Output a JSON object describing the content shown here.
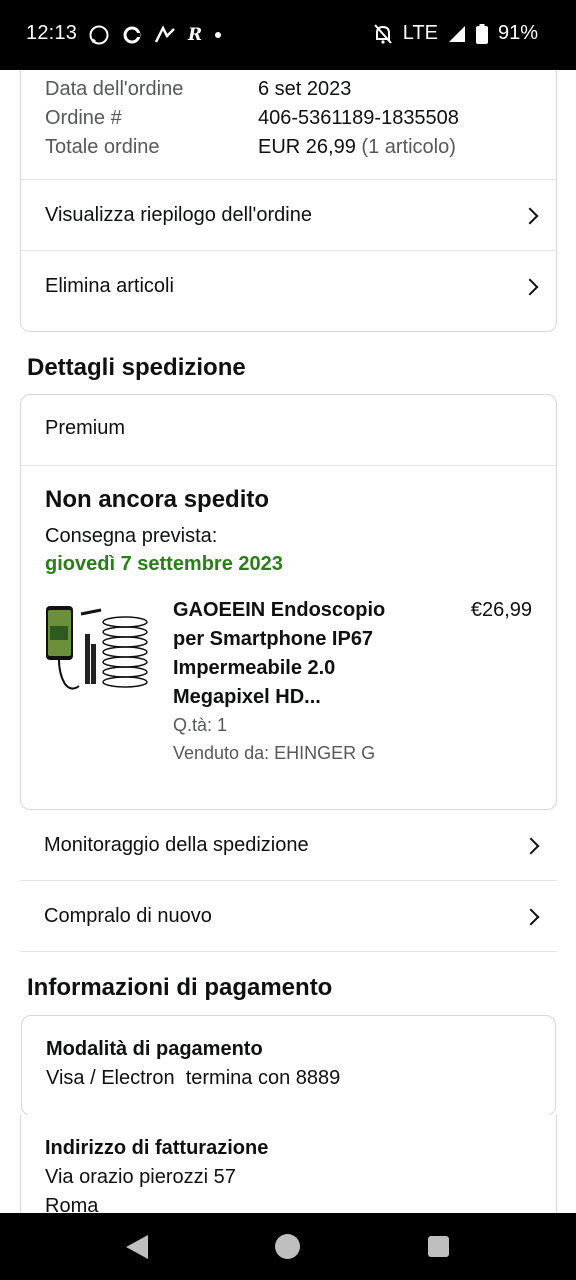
{
  "status_bar": {
    "time": "12:13",
    "network": "LTE",
    "battery": "91%",
    "icons": [
      "whatsapp-icon",
      "sync-icon",
      "app-icon",
      "r-icon",
      "dot-icon",
      "silent-icon",
      "signal-icon",
      "battery-icon"
    ]
  },
  "order_summary": {
    "date_label": "Data dell'ordine",
    "date_value": "6 set 2023",
    "order_label": "Ordine #",
    "order_value": "406-5361189-1835508",
    "total_label": "Totale ordine",
    "total_value": "EUR 26,99",
    "total_items": "(1 articolo)",
    "links": [
      {
        "label": "Visualizza riepilogo dell'ordine"
      },
      {
        "label": "Elimina articoli"
      }
    ]
  },
  "shipping": {
    "section_title": "Dettagli spedizione",
    "service": "Premium",
    "status": "Non ancora spedito",
    "delivery_label": "Consegna prevista:",
    "delivery_date": "giovedì 7 settembre 2023",
    "item": {
      "title": "GAOEEIN Endoscopio per Smartphone IP67 Impermeabile 2.0 Megapixel HD...",
      "price": "€26,99",
      "qty": "Q.tà: 1",
      "seller": "Venduto da: EHINGER G"
    },
    "links": [
      {
        "label": "Monitoraggio della spedizione"
      },
      {
        "label": "Compralo di nuovo"
      }
    ]
  },
  "payment": {
    "section_title": "Informazioni di pagamento",
    "method_label": "Modalità di pagamento",
    "method_value": "Visa / Electron  termina con 8889",
    "billing_label": "Indirizzo di fatturazione",
    "billing_line1": "Via orazio pierozzi 57",
    "billing_line2": "Roma"
  },
  "colors": {
    "accent_green": "#2a7e19",
    "border": "#d5d9d9",
    "text": "#0f1111",
    "muted": "#565959"
  }
}
